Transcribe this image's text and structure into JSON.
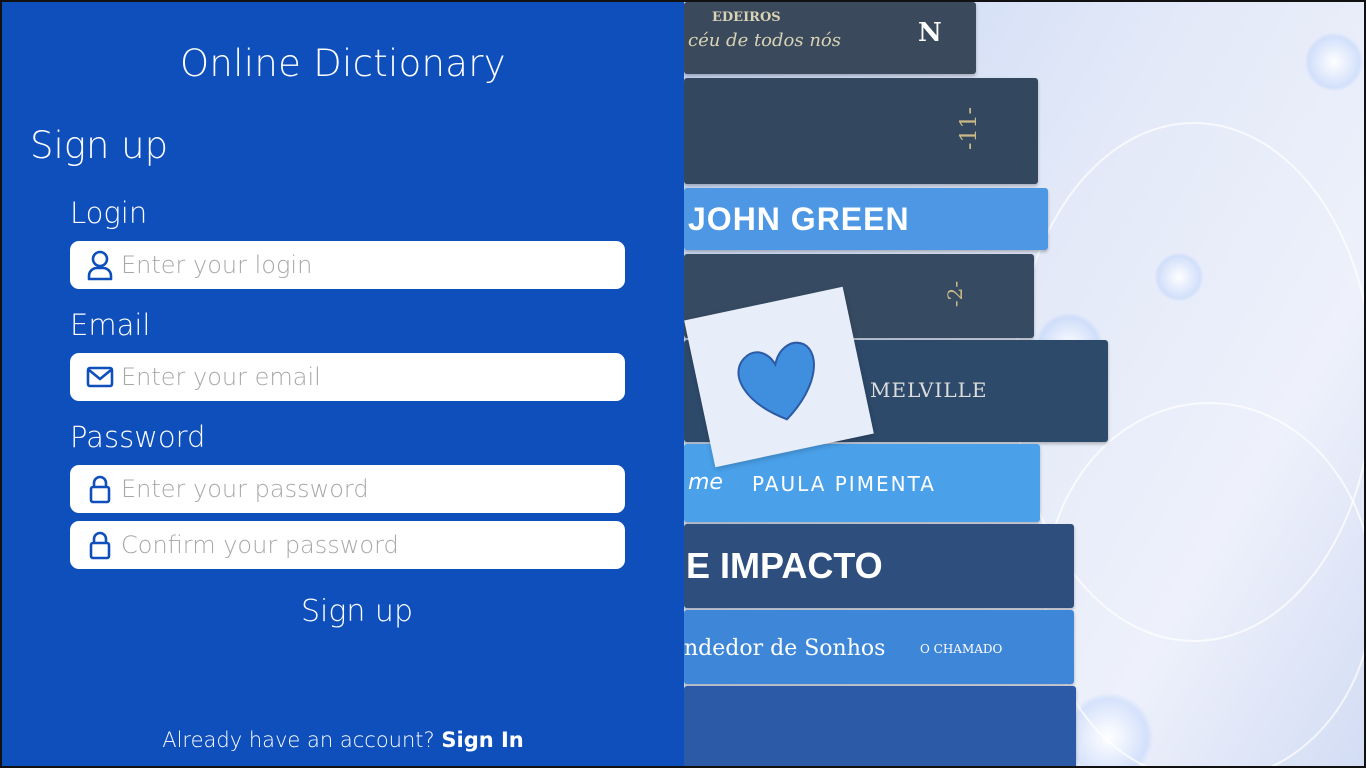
{
  "app_title": "Online Dictionary",
  "form": {
    "heading": "Sign up",
    "login_label": "Login",
    "login_placeholder": "Enter your login",
    "email_label": "Email",
    "email_placeholder": "Enter your email",
    "password_label": "Password",
    "password_placeholder": "Enter your password",
    "confirm_placeholder": "Confirm your password",
    "submit_label": "Sign up"
  },
  "footer": {
    "prompt": "Already have an account?",
    "signin_link": "Sign In"
  },
  "colors": {
    "panel_bg": "#0e4fbb",
    "input_bg": "#ffffff",
    "icon_color": "#0e4fbb",
    "placeholder_color": "#a8a8a8"
  },
  "image_spines": {
    "book1a": "EDEIROS",
    "book1b": "céu de todos nós",
    "book1c": "N",
    "book2": "-11-",
    "book3a": "JOHN GREEN",
    "book4": "-2-",
    "book5": "MELVILLE",
    "book6a": "me",
    "book6b": "PAULA PIMENTA",
    "book7": "E IMPACTO",
    "book8a": "ndedor de Sonhos",
    "book8b": "O CHAMADO"
  }
}
